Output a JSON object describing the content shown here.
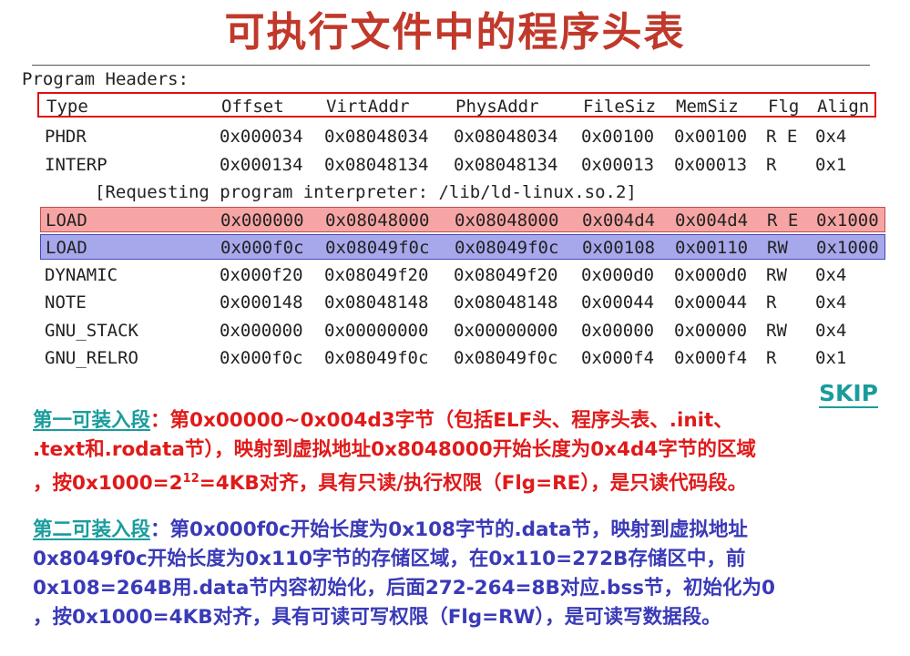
{
  "title": "可执行文件中的程序头表",
  "colors": {
    "title": "#c0392b",
    "header_box": "#e01010",
    "highlight_red": "#f7a4a4",
    "highlight_blue": "#a7a8ec",
    "teal": "#1a9c9c",
    "red_text": "#e01a1a",
    "blue_text": "#3a3ab8"
  },
  "table": {
    "section_label": "Program Headers:",
    "columns": [
      "Type",
      "Offset",
      "VirtAddr",
      "PhysAddr",
      "FileSiz",
      "MemSiz",
      "Flg",
      "Align"
    ],
    "rows": [
      [
        "PHDR",
        "0x000034",
        "0x08048034",
        "0x08048034",
        "0x00100",
        "0x00100",
        "R E",
        "0x4"
      ],
      [
        "INTERP",
        "0x000134",
        "0x08048134",
        "0x08048134",
        "0x00013",
        "0x00013",
        "R",
        "0x1"
      ],
      [
        "LOAD",
        "0x000000",
        "0x08048000",
        "0x08048000",
        "0x004d4",
        "0x004d4",
        "R E",
        "0x1000"
      ],
      [
        "LOAD",
        "0x000f0c",
        "0x08049f0c",
        "0x08049f0c",
        "0x00108",
        "0x00110",
        "RW",
        "0x1000"
      ],
      [
        "DYNAMIC",
        "0x000f20",
        "0x08049f20",
        "0x08049f20",
        "0x000d0",
        "0x000d0",
        "RW",
        "0x4"
      ],
      [
        "NOTE",
        "0x000148",
        "0x08048148",
        "0x08048148",
        "0x00044",
        "0x00044",
        "R",
        "0x4"
      ],
      [
        "GNU_STACK",
        "0x000000",
        "0x00000000",
        "0x00000000",
        "0x00000",
        "0x00000",
        "RW",
        "0x4"
      ],
      [
        "GNU_RELRO",
        "0x000f0c",
        "0x08049f0c",
        "0x08049f0c",
        "0x000f4",
        "0x000f4",
        "R",
        "0x1"
      ]
    ],
    "interp_note": "[Requesting program interpreter: /lib/ld-linux.so.2]"
  },
  "skip_label": "SKIP",
  "para1": {
    "lead": "第一可装入段",
    "line1_rest": "：第0x00000~0x004d3字节（包括ELF头、程序头表、.init、",
    "line2": ".text和.rodata节），映射到虚拟地址0x8048000开始长度为0x4d4字节的区域",
    "line3_a": "，按0x1000=2",
    "line3_sup": "12",
    "line3_b": "=4KB对齐，具有只读/执行权限（Flg=RE），是只读代码段。"
  },
  "para2": {
    "lead": "第二可装入段",
    "line1_rest": "：第0x000f0c开始长度为0x108字节的.data节，映射到虚拟地址",
    "line2": "0x8049f0c开始长度为0x110字节的存储区域，在0x110=272B存储区中，前",
    "line3": "0x108=264B用.data节内容初始化，后面272-264=8B对应.bss节，初始化为0",
    "line4": "，按0x1000=4KB对齐，具有可读可写权限（Flg=RW），是可读写数据段。"
  }
}
